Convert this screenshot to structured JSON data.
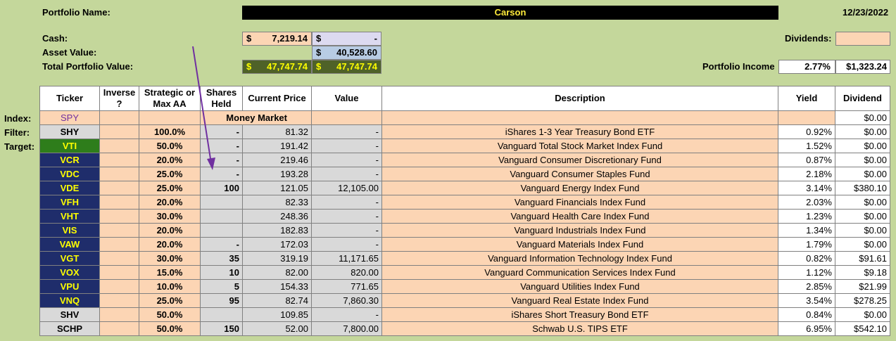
{
  "header": {
    "portfolio_name_label": "Portfolio Name:",
    "portfolio_name": "Carson",
    "date": "12/23/2022",
    "cash_label": "Cash:",
    "asset_value_label": "Asset Value:",
    "total_label": "Total Portfolio Value:",
    "dividends_label": "Dividends:",
    "portfolio_income_label": "Portfolio Income",
    "portfolio_income_pct": "2.77%",
    "portfolio_income_amt": "$1,323.24",
    "currency": "$",
    "cash_a": "7,219.14",
    "cash_b": "-",
    "asset_value": "40,528.60",
    "total_a": "47,747.74",
    "total_b": "47,747.74"
  },
  "side_labels": {
    "index": "Index:",
    "filter": "Filter:",
    "target": "Target:"
  },
  "columns": {
    "ticker": "Ticker",
    "inverse": "Inverse ?",
    "strategic": "Strategic or Max AA",
    "shares": "Shares Held",
    "price": "Current Price",
    "value": "Value",
    "description": "Description",
    "yield": "Yield",
    "dividend": "Dividend"
  },
  "index_row": {
    "ticker": "SPY",
    "money_market": "Money Market",
    "dividend": "$0.00"
  },
  "rows": [
    {
      "ticker": "SHY",
      "style": "grey",
      "aa": "100.0%",
      "shares": "-",
      "price": "81.32",
      "value": "-",
      "desc": "iShares 1-3 Year Treasury Bond ETF",
      "yield": "0.92%",
      "div": "$0.00"
    },
    {
      "ticker": "VTI",
      "style": "green",
      "aa": "50.0%",
      "shares": "-",
      "price": "191.42",
      "value": "-",
      "desc": "Vanguard Total Stock Market Index Fund",
      "yield": "1.52%",
      "div": "$0.00"
    },
    {
      "ticker": "VCR",
      "style": "navy",
      "aa": "20.0%",
      "shares": "-",
      "price": "219.46",
      "value": "-",
      "desc": "Vanguard Consumer Discretionary Fund",
      "yield": "0.87%",
      "div": "$0.00"
    },
    {
      "ticker": "VDC",
      "style": "navy",
      "aa": "25.0%",
      "shares": "-",
      "price": "193.28",
      "value": "-",
      "desc": "Vanguard Consumer Staples Fund",
      "yield": "2.18%",
      "div": "$0.00"
    },
    {
      "ticker": "VDE",
      "style": "navy",
      "aa": "25.0%",
      "shares": "100",
      "price": "121.05",
      "value": "12,105.00",
      "desc": "Vanguard Energy Index Fund",
      "yield": "3.14%",
      "div": "$380.10"
    },
    {
      "ticker": "VFH",
      "style": "navy",
      "aa": "20.0%",
      "shares": "",
      "price": "82.33",
      "value": "-",
      "desc": "Vanguard Financials Index Fund",
      "yield": "2.03%",
      "div": "$0.00"
    },
    {
      "ticker": "VHT",
      "style": "navy",
      "aa": "30.0%",
      "shares": "",
      "price": "248.36",
      "value": "-",
      "desc": "Vanguard Health Care Index Fund",
      "yield": "1.23%",
      "div": "$0.00"
    },
    {
      "ticker": "VIS",
      "style": "navy",
      "aa": "20.0%",
      "shares": "",
      "price": "182.83",
      "value": "-",
      "desc": "Vanguard Industrials Index Fund",
      "yield": "1.34%",
      "div": "$0.00"
    },
    {
      "ticker": "VAW",
      "style": "navy",
      "aa": "20.0%",
      "shares": "-",
      "price": "172.03",
      "value": "-",
      "desc": "Vanguard Materials Index Fund",
      "yield": "1.79%",
      "div": "$0.00"
    },
    {
      "ticker": "VGT",
      "style": "navy",
      "aa": "30.0%",
      "shares": "35",
      "price": "319.19",
      "value": "11,171.65",
      "desc": "Vanguard Information Technology Index Fund",
      "yield": "0.82%",
      "div": "$91.61"
    },
    {
      "ticker": "VOX",
      "style": "navy",
      "aa": "15.0%",
      "shares": "10",
      "price": "82.00",
      "value": "820.00",
      "desc": "Vanguard Communication Services Index Fund",
      "yield": "1.12%",
      "div": "$9.18"
    },
    {
      "ticker": "VPU",
      "style": "navy",
      "aa": "10.0%",
      "shares": "5",
      "price": "154.33",
      "value": "771.65",
      "desc": "Vanguard Utilities Index Fund",
      "yield": "2.85%",
      "div": "$21.99"
    },
    {
      "ticker": "VNQ",
      "style": "navy",
      "aa": "25.0%",
      "shares": "95",
      "price": "82.74",
      "value": "7,860.30",
      "desc": "Vanguard Real Estate Index Fund",
      "yield": "3.54%",
      "div": "$278.25"
    },
    {
      "ticker": "SHV",
      "style": "grey",
      "aa": "50.0%",
      "shares": "",
      "price": "109.85",
      "value": "-",
      "desc": "iShares Short Treasury Bond ETF",
      "yield": "0.84%",
      "div": "$0.00"
    },
    {
      "ticker": "SCHP",
      "style": "grey",
      "aa": "50.0%",
      "shares": "150",
      "price": "52.00",
      "value": "7,800.00",
      "desc": "Schwab U.S. TIPS ETF",
      "yield": "6.95%",
      "div": "$542.10"
    }
  ],
  "colors": {
    "background": "#c4d79b",
    "navy": "#1f2d6b",
    "green": "#2e7d1b",
    "peach": "#fcd5b4",
    "arrow": "#7030a0"
  },
  "icons": {
    "annotation_arrow": "arrow-icon"
  }
}
